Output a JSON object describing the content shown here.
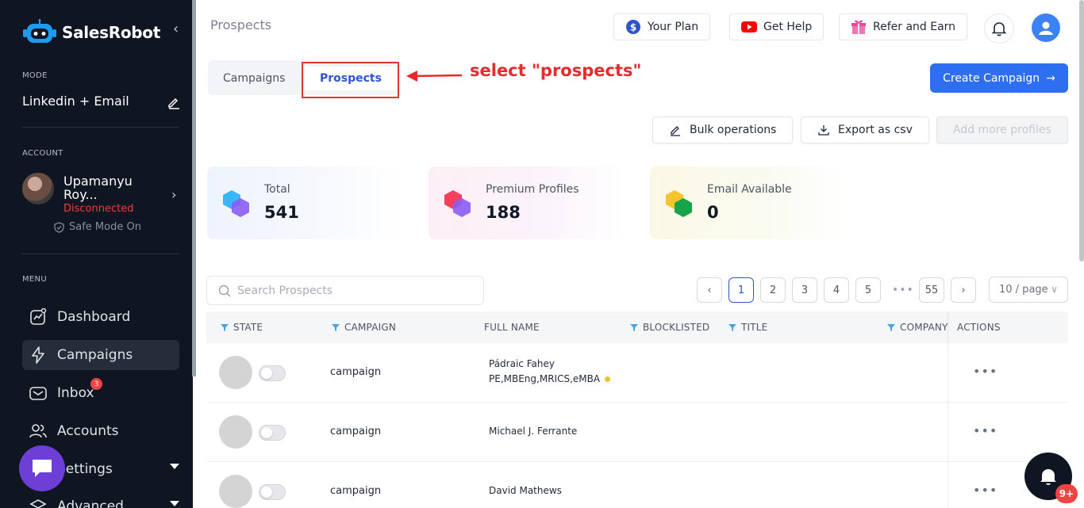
{
  "brand": {
    "name": "SalesRobot"
  },
  "sidebar": {
    "mode_label": "MODE",
    "mode_value": "Linkedin + Email",
    "account_label": "ACCOUNT",
    "account_name": "Upamanyu Roy...",
    "account_status": "Disconnected",
    "safe_mode": "Safe Mode On",
    "menu_label": "MENU",
    "items": [
      {
        "label": "Dashboard",
        "icon": "chart-line-icon"
      },
      {
        "label": "Campaigns",
        "icon": "lightning-icon"
      },
      {
        "label": "Inbox",
        "icon": "mail-icon",
        "badge": "3"
      },
      {
        "label": "Accounts",
        "icon": "users-icon"
      },
      {
        "label": "Settings",
        "icon": "gear-icon"
      },
      {
        "label": "Advanced",
        "icon": "layers-icon"
      }
    ]
  },
  "header": {
    "title": "Prospects",
    "your_plan": "Your Plan",
    "get_help": "Get Help",
    "refer": "Refer and Earn"
  },
  "tabs": [
    {
      "label": "Campaigns"
    },
    {
      "label": "Prospects",
      "active": true
    }
  ],
  "annotation": {
    "text": "select \"prospects\"",
    "color": "#e52b2b"
  },
  "actions": {
    "create": "Create Campaign",
    "bulk": "Bulk operations",
    "export": "Export as csv",
    "add_more": "Add more profiles"
  },
  "stats": [
    {
      "label": "Total",
      "value": "541"
    },
    {
      "label": "Premium Profiles",
      "value": "188"
    },
    {
      "label": "Email Available",
      "value": "0"
    }
  ],
  "search": {
    "placeholder": "Search Prospects"
  },
  "pagination": {
    "pages": [
      "1",
      "2",
      "3",
      "4",
      "5"
    ],
    "ellipsis": "•••",
    "last": "55",
    "current": "1",
    "per_page": "10 / page"
  },
  "table": {
    "columns": [
      "STATE",
      "CAMPAIGN",
      "FULL NAME",
      "BLOCKLISTED",
      "TITLE",
      "COMPANY",
      "ACTIONS"
    ],
    "rows": [
      {
        "campaign": "campaign",
        "name": "Pádraic Fahey",
        "name2": "PE,MBEng,MRICS,eMBA"
      },
      {
        "campaign": "campaign",
        "name": "Michael J. Ferrante"
      },
      {
        "campaign": "campaign",
        "name": "David Mathews"
      }
    ]
  },
  "notifications": {
    "badge": "9+"
  },
  "colors": {
    "accent": "#2e6ef0",
    "sidebar": "#0f1622",
    "danger": "#ef4444"
  }
}
